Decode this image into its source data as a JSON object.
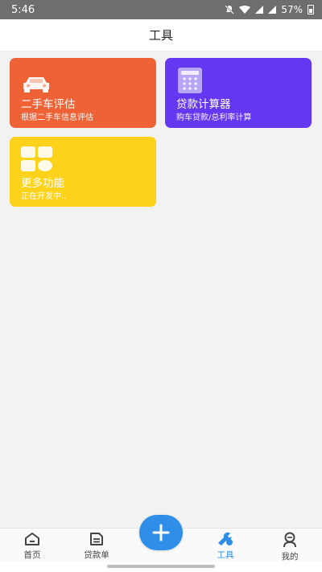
{
  "status": {
    "time": "5:46",
    "battery": "57%"
  },
  "header": {
    "title": "工具"
  },
  "tools": [
    {
      "title": "二手车评估",
      "subtitle": "根据二手车信息评估",
      "icon": "car-icon",
      "color": "#ef6236"
    },
    {
      "title": "贷款计算器",
      "subtitle": "购车贷款/总利率计算",
      "icon": "calculator-icon",
      "color": "#6338f0"
    },
    {
      "title": "更多功能",
      "subtitle": "正在开发中..",
      "icon": "apps-grid-icon",
      "color": "#fdd21b"
    }
  ],
  "tabs": [
    {
      "label": "首页",
      "icon": "home-icon"
    },
    {
      "label": "贷款单",
      "icon": "document-icon"
    },
    {
      "label": "工具",
      "icon": "wrench-icon",
      "active": true
    },
    {
      "label": "我的",
      "icon": "user-icon"
    }
  ],
  "fab": {
    "icon": "plus-icon"
  },
  "colors": {
    "accent": "#2f8fe8"
  }
}
